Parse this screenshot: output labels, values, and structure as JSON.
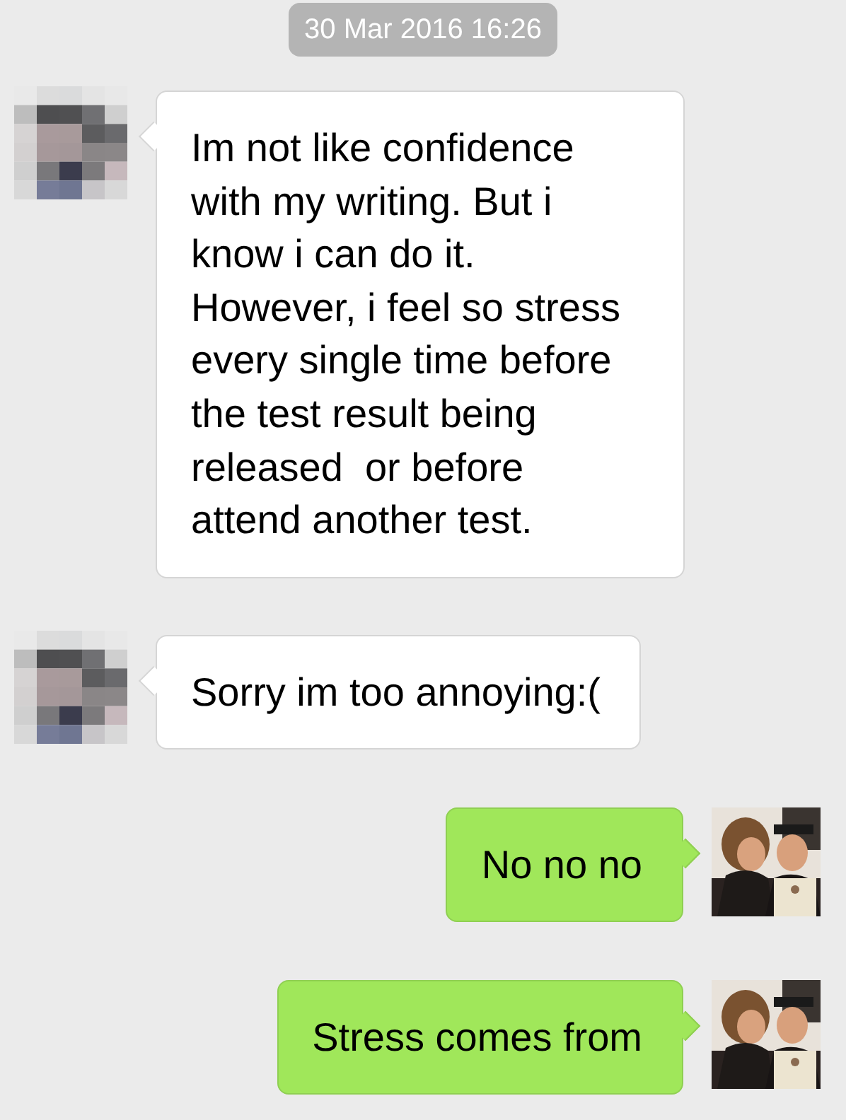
{
  "timestamp": "30 Mar 2016 16:26",
  "messages": [
    {
      "kind": "received",
      "text": "Im not like confidence with my writing. But i know i can do it. However, i feel so stress every single time before the test result being released  or before attend another test."
    },
    {
      "kind": "received",
      "text": "Sorry im too annoying:("
    },
    {
      "kind": "sent",
      "text": "No no no"
    },
    {
      "kind": "sent",
      "text": "Stress comes from"
    }
  ]
}
